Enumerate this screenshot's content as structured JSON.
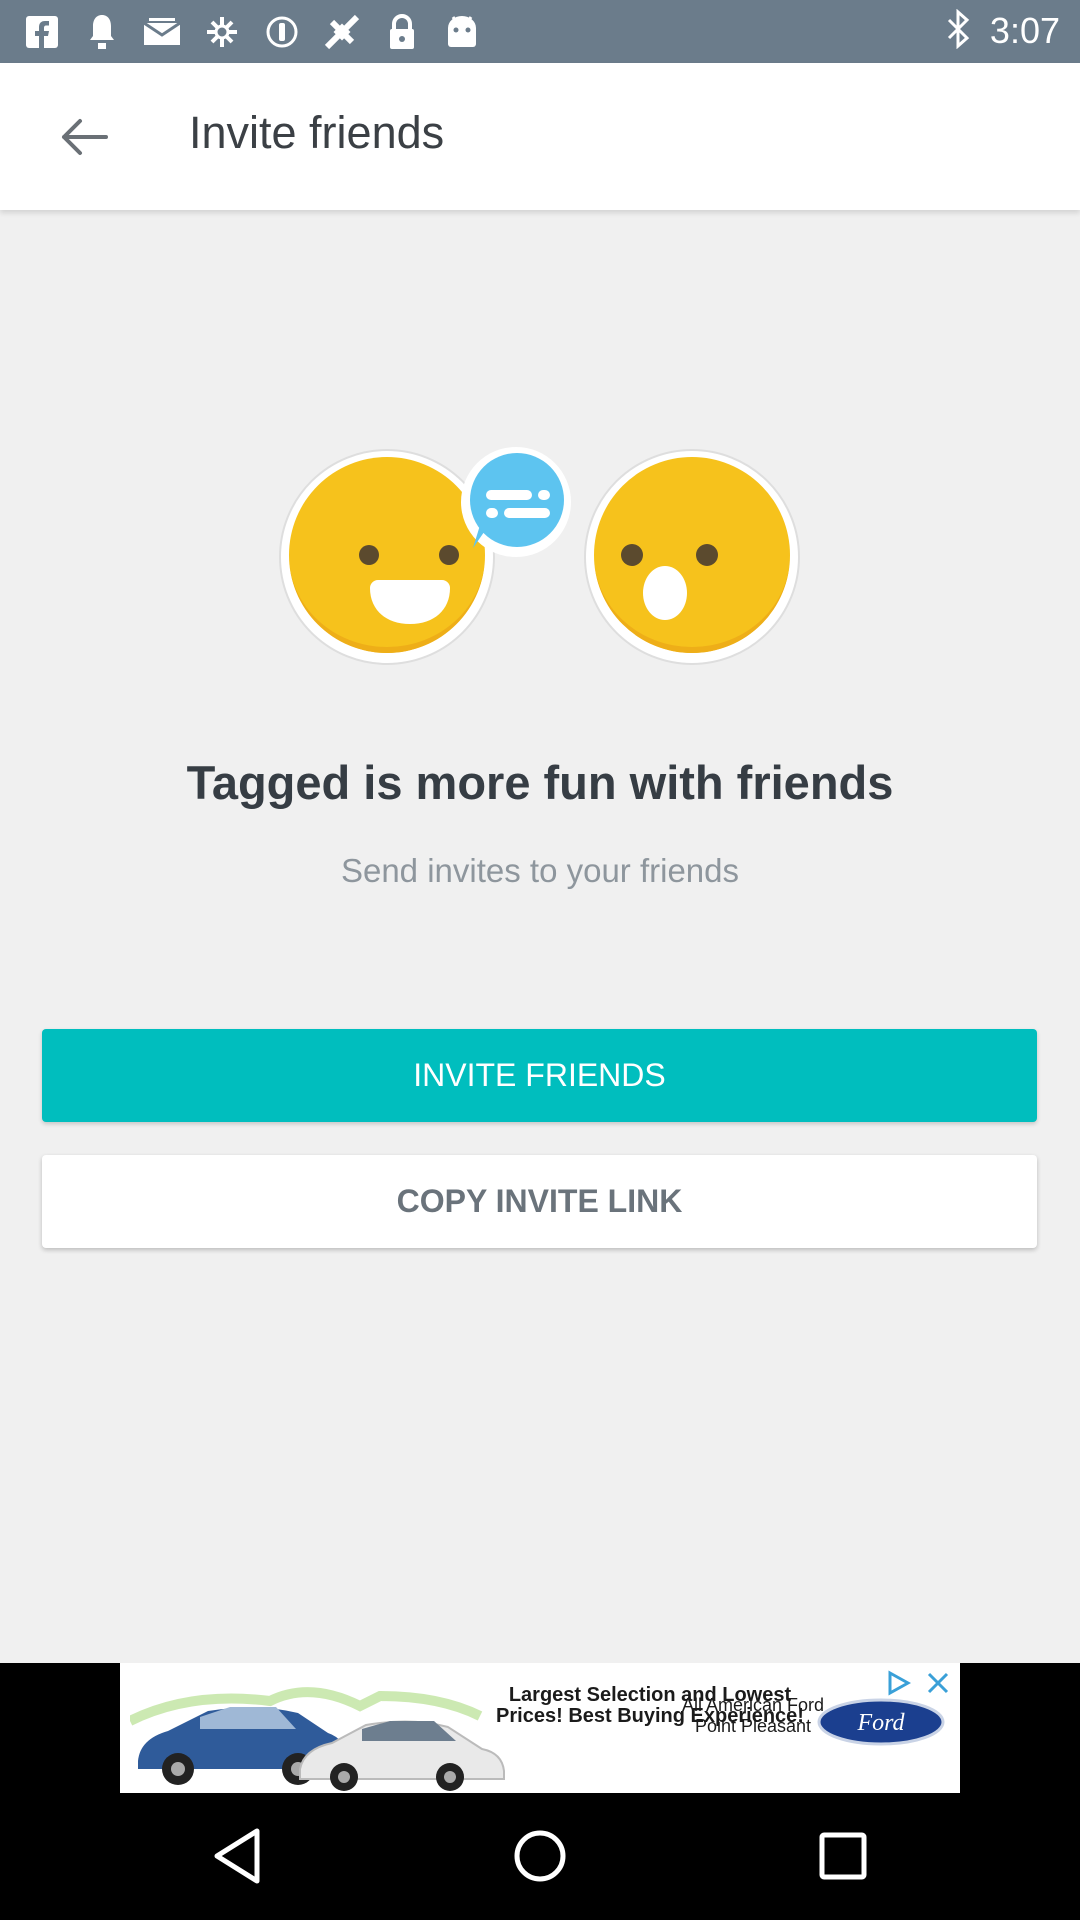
{
  "status_bar": {
    "time": "3:07",
    "left_icons": [
      "facebook-icon",
      "notification-icon",
      "mail-icon",
      "settings-icon",
      "alert-icon",
      "satellite-icon",
      "lock-icon",
      "android-icon"
    ],
    "right_icons": [
      "bluetooth-icon"
    ]
  },
  "app_bar": {
    "title": "Invite friends",
    "back_icon": "arrow-back-icon"
  },
  "main": {
    "headline": "Tagged is more fun with friends",
    "subline": "Send invites to your friends",
    "invite_button": "INVITE FRIENDS",
    "copy_button": "COPY INVITE LINK"
  },
  "ad": {
    "headline": "Largest Selection and Lowest Prices! Best Buying Experience!",
    "dealer": "All American Ford Point Pleasant",
    "brand": "Ford"
  },
  "nav_bar": {
    "icons": [
      "back-triangle-icon",
      "home-circle-icon",
      "recents-square-icon"
    ]
  },
  "colors": {
    "status_bar": "#6b7c8b",
    "accent": "#00bebe",
    "emoji_yellow": "#f6c21c",
    "bubble_blue": "#5dc4f0"
  }
}
